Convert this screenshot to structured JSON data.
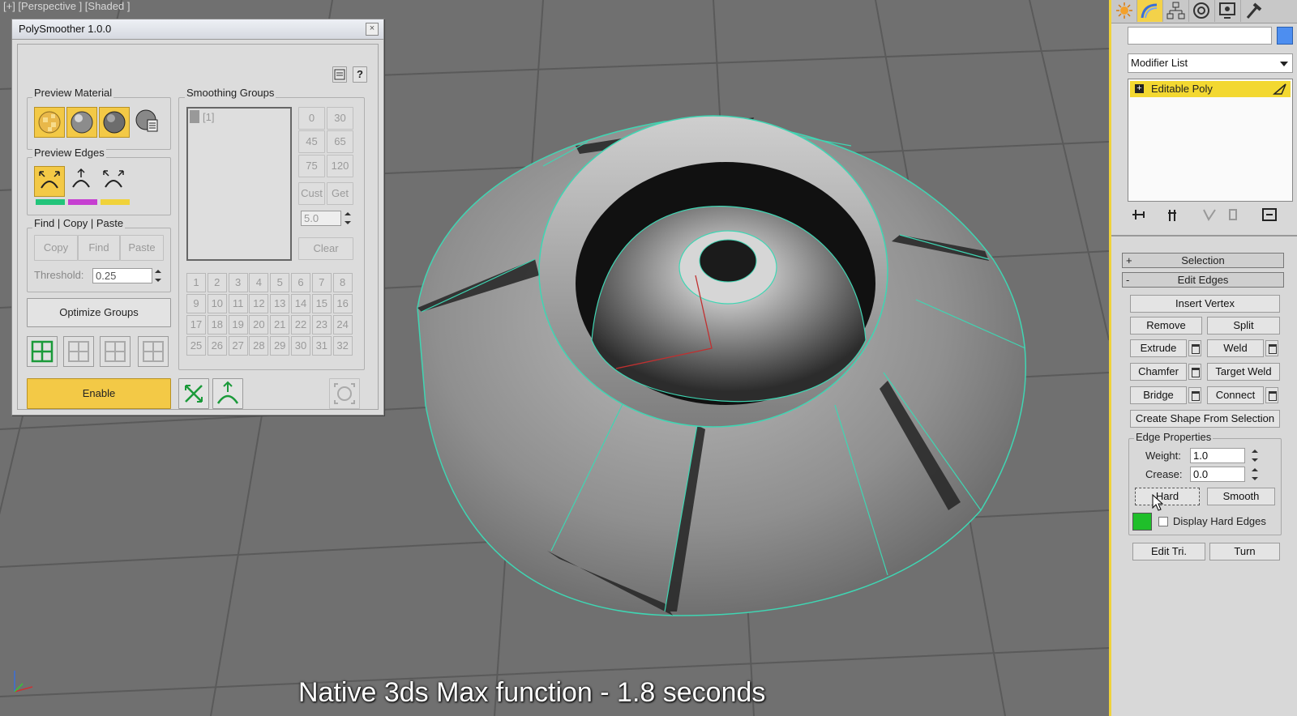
{
  "viewport": {
    "label": "[+] [Perspective ] [Shaded ]",
    "caption": "Native 3ds Max function  -  1.8 seconds",
    "axis_labels": {
      "x": "x",
      "z": "z"
    }
  },
  "dialog": {
    "title": "PolySmoother 1.0.0",
    "close_glyph": "×",
    "help_glyph": "?",
    "preview_material": {
      "label": "Preview Material"
    },
    "preview_edges": {
      "label": "Preview Edges",
      "colors": [
        "#22c47a",
        "#c63fd1",
        "#f0d23a"
      ]
    },
    "find_copy_paste": {
      "label": "Find | Copy | Paste",
      "copy": "Copy",
      "find": "Find",
      "paste": "Paste",
      "threshold_label": "Threshold:",
      "threshold_value": "0.25"
    },
    "optimize_groups": "Optimize Groups",
    "enable": "Enable",
    "smoothing_groups": {
      "label": "Smoothing Groups",
      "list_item": "[1]",
      "angles": [
        "0",
        "30",
        "45",
        "65",
        "75",
        "120"
      ],
      "cust": "Cust",
      "get": "Get",
      "angle_value": "5.0",
      "clear": "Clear",
      "groups": [
        "1",
        "2",
        "3",
        "4",
        "5",
        "6",
        "7",
        "8",
        "9",
        "10",
        "11",
        "12",
        "13",
        "14",
        "15",
        "16",
        "17",
        "18",
        "19",
        "20",
        "21",
        "22",
        "23",
        "24",
        "25",
        "26",
        "27",
        "28",
        "29",
        "30",
        "31",
        "32"
      ]
    }
  },
  "panel": {
    "name_field": "",
    "modifier_list": "Modifier List",
    "stack_item": "Editable Poly",
    "rollouts": {
      "selection": "Selection",
      "edit_edges": "Edit Edges",
      "plus": "+",
      "minus": "-"
    },
    "buttons": {
      "insert_vertex": "Insert Vertex",
      "remove": "Remove",
      "split": "Split",
      "extrude": "Extrude",
      "weld": "Weld",
      "chamfer": "Chamfer",
      "target_weld": "Target Weld",
      "bridge": "Bridge",
      "connect": "Connect",
      "create_shape": "Create Shape From Selection",
      "hard": "Hard",
      "smooth": "Smooth",
      "edit_tri": "Edit Tri.",
      "turn": "Turn"
    },
    "edge_properties": {
      "label": "Edge Properties",
      "weight_label": "Weight:",
      "weight_value": "1.0",
      "crease_label": "Crease:",
      "crease_value": "0.0",
      "display_hard_edges": "Display Hard Edges",
      "hard_edge_color": "#1fbf2a"
    }
  }
}
